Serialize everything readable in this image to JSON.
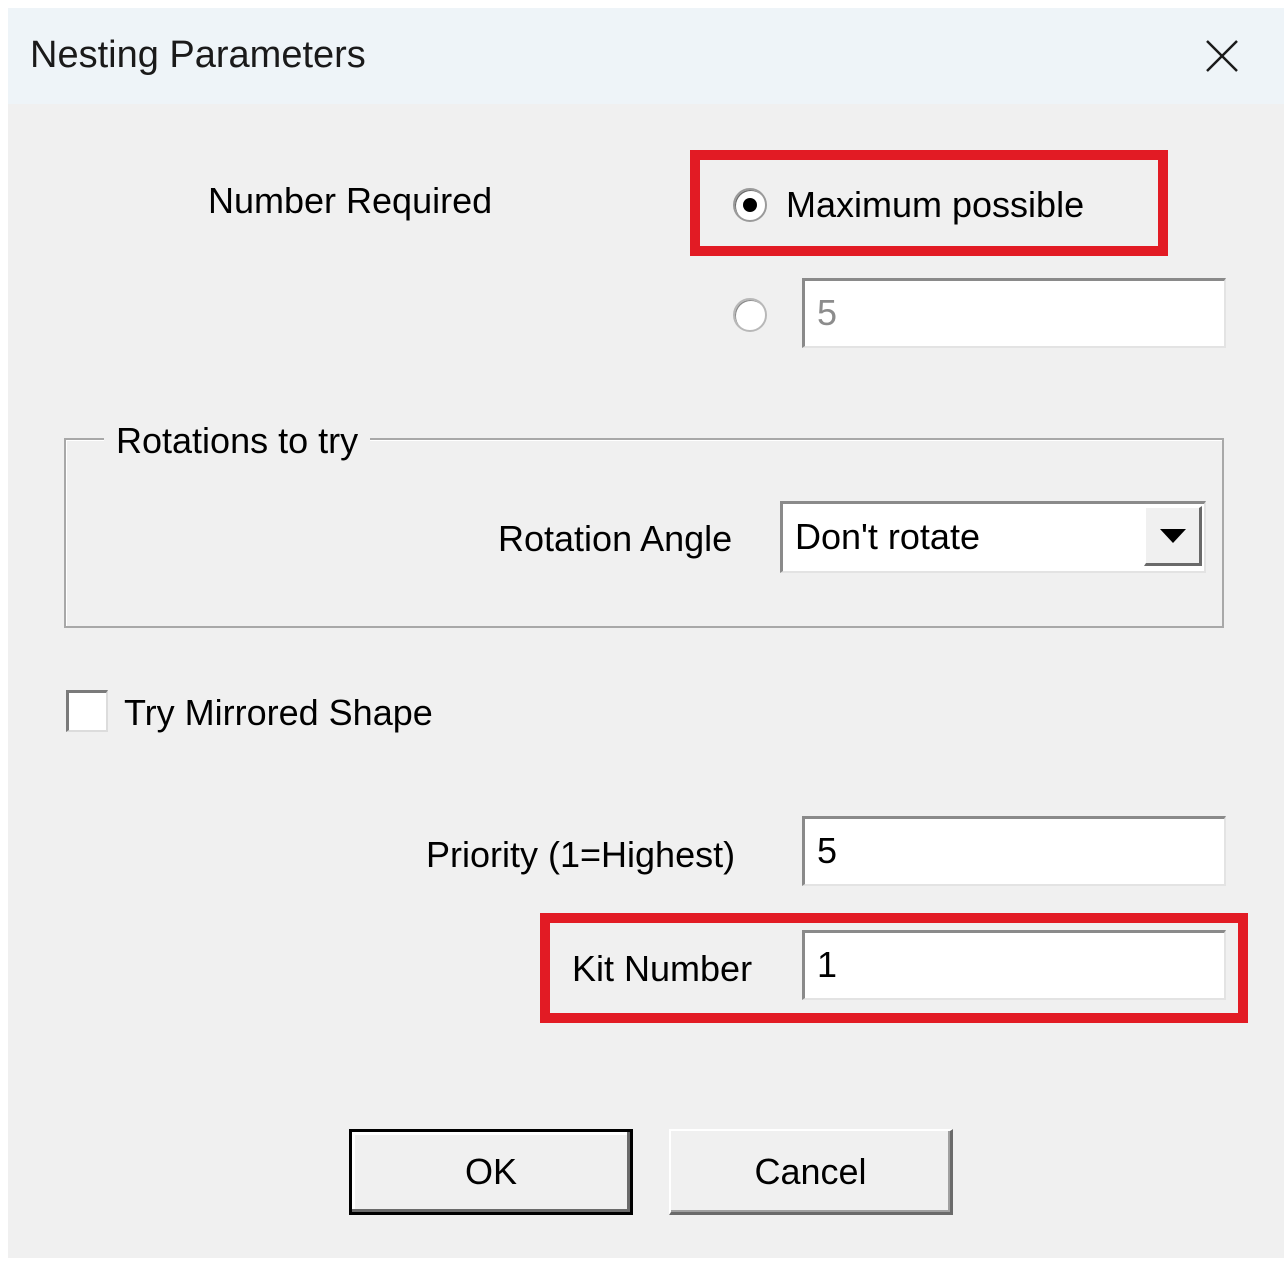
{
  "window": {
    "title": "Nesting Parameters"
  },
  "number_required": {
    "label": "Number Required",
    "option_maximum_label": "Maximum possible",
    "option_maximum_selected": true,
    "option_custom_selected": false,
    "custom_value": "5"
  },
  "rotations_group": {
    "legend": "Rotations to try",
    "rotation_angle_label": "Rotation Angle",
    "rotation_angle_value": "Don't rotate"
  },
  "mirrored": {
    "label": "Try Mirrored Shape",
    "checked": false
  },
  "priority": {
    "label": "Priority (1=Highest)",
    "value": "5"
  },
  "kit_number": {
    "label": "Kit Number",
    "value": "1"
  },
  "buttons": {
    "ok_label": "OK",
    "cancel_label": "Cancel"
  },
  "colors": {
    "highlight": "#e21b24",
    "dialog_bg": "#f0f0f0",
    "titlebar_bg": "#eef4f8"
  },
  "icons": {
    "close": "close-icon",
    "dropdown": "chevron-down-icon"
  }
}
